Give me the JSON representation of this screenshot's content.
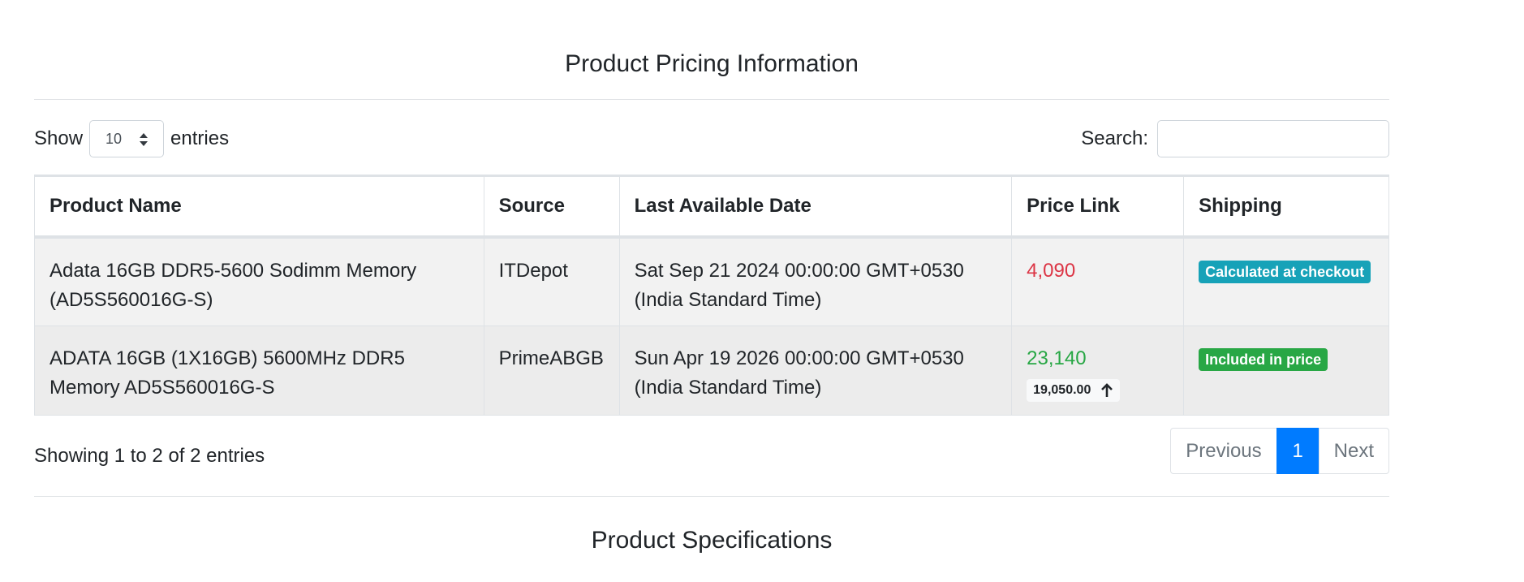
{
  "pricing": {
    "title": "Product Pricing Information",
    "length_prefix": "Show",
    "length_value": "10",
    "length_suffix": "entries",
    "search_label": "Search:",
    "search_value": "",
    "columns": [
      "Product Name",
      "Source",
      "Last Available Date",
      "Price Link",
      "Shipping"
    ],
    "rows": [
      {
        "product_line1": "Adata 16GB DDR5-5600 Sodimm Memory",
        "product_line2": "(AD5S560016G-S)",
        "source": "ITDepot",
        "date_line1": "Sat Sep 21 2024 00:00:00 GMT+0530",
        "date_line2": "(India Standard Time)",
        "price": "4,090",
        "shipping": "Calculated at checkout"
      },
      {
        "product_line1": "ADATA 16GB (1X16GB) 5600MHz DDR5",
        "product_line2": "Memory AD5S560016G-S",
        "source": "PrimeABGB",
        "date_line1": "Sun Apr 19 2026 00:00:00 GMT+0530",
        "date_line2": "(India Standard Time)",
        "price": "23,140",
        "previous_price": "19,050.00",
        "shipping": "Included in price"
      }
    ],
    "info": "Showing 1 to 2 of 2 entries",
    "pagination": {
      "previous": "Previous",
      "current": "1",
      "next": "Next"
    }
  },
  "specifications": {
    "title": "Product Specifications"
  },
  "colors": {
    "accent": "#007bff",
    "price_low": "#dc3545",
    "price_high": "#28a745",
    "badge_info": "#17a2b8",
    "badge_success": "#28a745"
  },
  "icons": {
    "select_arrows": "sort-arrows-icon",
    "price_change": "arrow-up-icon"
  }
}
